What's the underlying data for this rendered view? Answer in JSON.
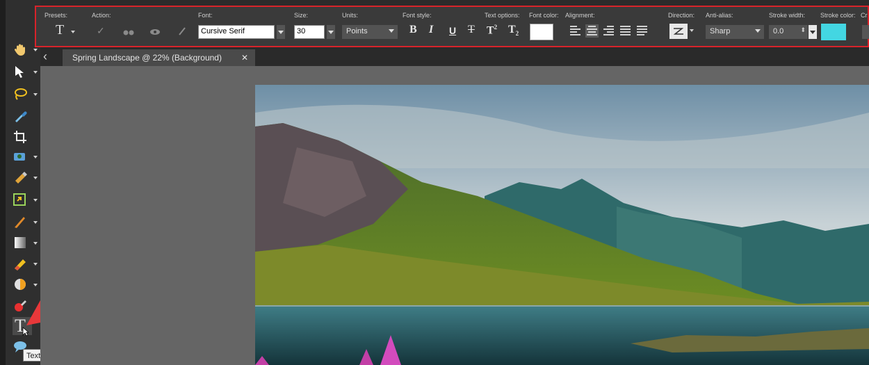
{
  "toolbar": {
    "presets_label": "Presets:",
    "action_label": "Action:",
    "font_label": "Font:",
    "font_value": "Cursive Serif",
    "size_label": "Size:",
    "size_value": "30",
    "units_label": "Units:",
    "units_value": "Points",
    "fontstyle_label": "Font style:",
    "textoptions_label": "Text options:",
    "fontcolor_label": "Font color:",
    "alignment_label": "Alignment:",
    "direction_label": "Direction:",
    "antialias_label": "Anti-alias:",
    "antialias_value": "Sharp",
    "strokewidth_label": "Stroke width:",
    "strokewidth_value": "0.0",
    "strokecolor_label": "Stroke color:",
    "trailing_label": "Cr",
    "preset_glyph": "T",
    "bold": "B",
    "italic": "I",
    "underline": "U",
    "strike": "T",
    "superscript_base": "T",
    "superscript_exp": "2",
    "subscript_base": "T",
    "subscript_sub": "2",
    "font_color": "#ffffff",
    "stroke_color": "#43d6e2",
    "highlight_border": "#d8232a"
  },
  "document": {
    "tab_title": "Spring Landscape @  22% (Background)",
    "close_glyph": "✕",
    "back_glyph": "‹"
  },
  "tools": [
    {
      "name": "pan-tool-icon"
    },
    {
      "name": "pick-tool-icon"
    },
    {
      "name": "lasso-selection-icon"
    },
    {
      "name": "eyedropper-icon"
    },
    {
      "name": "crop-icon"
    },
    {
      "name": "red-eye-icon"
    },
    {
      "name": "clone-brush-icon"
    },
    {
      "name": "scratch-remover-icon"
    },
    {
      "name": "paint-brush-icon"
    },
    {
      "name": "gradient-fill-icon"
    },
    {
      "name": "eraser-icon"
    },
    {
      "name": "dodge-icon"
    },
    {
      "name": "color-replacer-icon"
    },
    {
      "name": "text-tool-icon"
    },
    {
      "name": "speech-bubble-icon"
    }
  ],
  "tooltip": "Text Tool (T)",
  "arrow_color": "#e8383a"
}
